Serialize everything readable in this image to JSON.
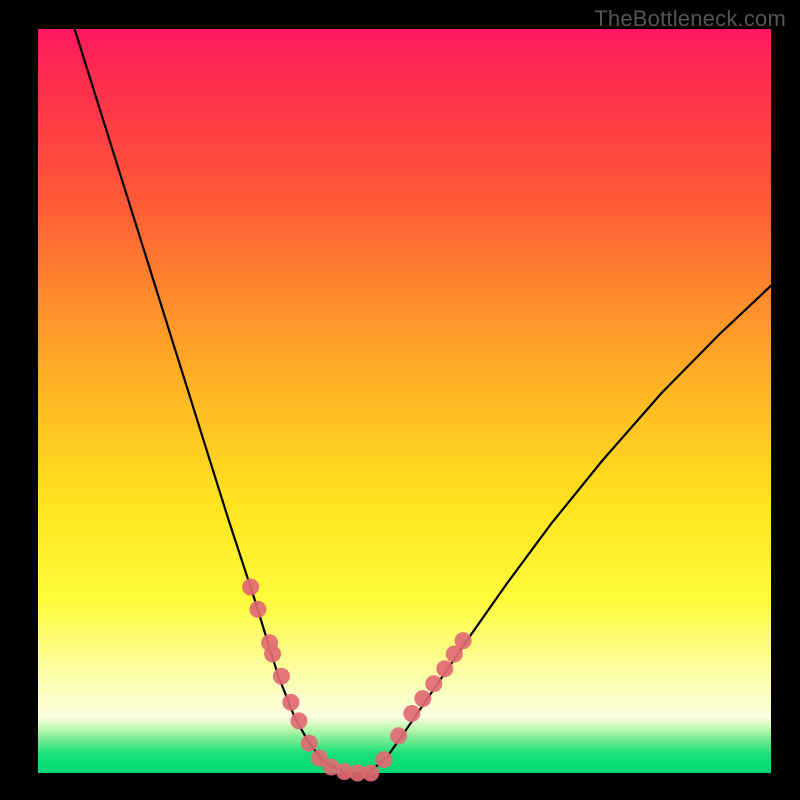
{
  "watermark": "TheBottleneck.com",
  "chart_data": {
    "type": "line",
    "title": "",
    "xlabel": "",
    "ylabel": "",
    "xlim": [
      0,
      1
    ],
    "ylim": [
      0,
      1
    ],
    "series": [
      {
        "name": "curve",
        "x": [
          0.05,
          0.085,
          0.12,
          0.155,
          0.19,
          0.225,
          0.26,
          0.295,
          0.328,
          0.35,
          0.37,
          0.39,
          0.42,
          0.45,
          0.475,
          0.5,
          0.545,
          0.59,
          0.64,
          0.7,
          0.77,
          0.85,
          0.93,
          1.0
        ],
        "y": [
          1.0,
          0.89,
          0.78,
          0.67,
          0.56,
          0.45,
          0.34,
          0.235,
          0.13,
          0.075,
          0.04,
          0.015,
          0.0,
          0.0,
          0.02,
          0.055,
          0.12,
          0.185,
          0.255,
          0.335,
          0.42,
          0.51,
          0.59,
          0.655
        ]
      }
    ],
    "markers": {
      "name": "highlighted-points",
      "x": [
        0.29,
        0.3,
        0.316,
        0.32,
        0.332,
        0.345,
        0.356,
        0.37,
        0.384,
        0.4,
        0.418,
        0.436,
        0.454,
        0.472,
        0.492,
        0.51,
        0.525,
        0.54,
        0.555,
        0.568,
        0.58
      ],
      "y": [
        0.25,
        0.22,
        0.175,
        0.16,
        0.13,
        0.095,
        0.07,
        0.04,
        0.02,
        0.008,
        0.002,
        0.0,
        0.0,
        0.018,
        0.05,
        0.08,
        0.1,
        0.12,
        0.14,
        0.16,
        0.178
      ]
    }
  }
}
